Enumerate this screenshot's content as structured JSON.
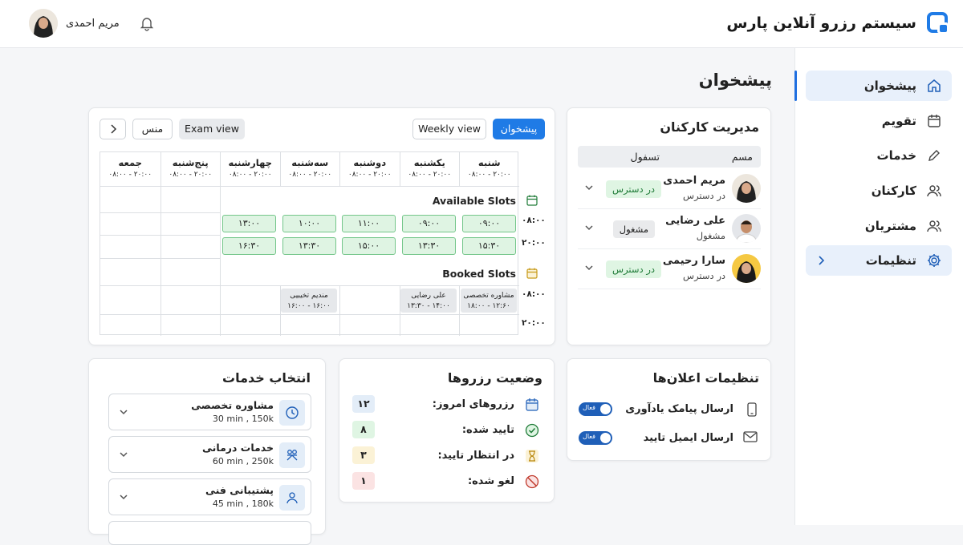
{
  "header": {
    "brand_title": "سیستم رزرو آنلاین پارس",
    "user_name": "مریم احمدی",
    "brand_color": "#1f7be6"
  },
  "sidebar": {
    "items": [
      {
        "label": "پیشخوان",
        "icon": "home-icon",
        "active": true
      },
      {
        "label": "تقویم",
        "icon": "calendar-icon"
      },
      {
        "label": "خدمات",
        "icon": "pencil-icon"
      },
      {
        "label": "کارکنان",
        "icon": "users-icon"
      },
      {
        "label": "مشتریان",
        "icon": "users-icon"
      },
      {
        "label": "تنظیمات",
        "icon": "gear-icon",
        "expandable": true
      }
    ]
  },
  "page": {
    "title": "پیشخوان"
  },
  "staff": {
    "title": "مدیریت کارکنان",
    "columns": [
      "مسم",
      "تسفول"
    ],
    "rows": [
      {
        "name": "مریم احمدی",
        "status": "در دسترس",
        "badge": "در دسترس",
        "badge_type": "green"
      },
      {
        "name": "علی رضایی",
        "status": "مشغول",
        "badge": "مشغول",
        "badge_type": "gray"
      },
      {
        "name": "سارا رحیمی",
        "status": "در دسترس",
        "badge": "در دسترس",
        "badge_type": "green"
      }
    ]
  },
  "calendar": {
    "buttons": {
      "dashboard": "پیشخوان",
      "weekly": "Weekly view",
      "exam": "Exam view",
      "more": "منس"
    },
    "days": [
      {
        "name": "شنبه",
        "hours": "۰۸:۰۰ - ۲۰:۰۰"
      },
      {
        "name": "یکشنبه",
        "hours": "۰۸:۰۰ - ۲۰:۰۰"
      },
      {
        "name": "دوشنبه",
        "hours": "۰۸:۰۰ - ۲۰:۰۰"
      },
      {
        "name": "سه‌شنبه",
        "hours": "۰۸:۰۰ - ۲۰:۰۰"
      },
      {
        "name": "چهارشنبه",
        "hours": "۰۸:۰۰ - ۲۰:۰۰"
      },
      {
        "name": "پنج‌شنبه",
        "hours": "۰۸:۰۰ - ۲۰:۰۰"
      },
      {
        "name": "جمعه",
        "hours": "۰۸:۰۰ - ۲۰:۰۰"
      }
    ],
    "available_label": "Available Slots",
    "booked_label": "Booked Slots",
    "time_labels": [
      "۰۸:۰۰",
      "۲۰:۰۰",
      "۰۸:۰۰",
      "۲۰:۰۰"
    ],
    "slots_row1": [
      "۰۹:۰۰",
      "۰۹:۰۰",
      "۱۱:۰۰",
      "۱۰:۰۰",
      "۱۳:۰۰"
    ],
    "slots_row2": [
      "۱۵:۳۰",
      "۱۳:۳۰",
      "۱۵:۰۰",
      "۱۳:۳۰",
      "۱۶:۳۰"
    ],
    "booked": [
      {
        "title": "مشاوره تخصصی",
        "time": "۱۸:۰۰ - ۱۲:۶۰"
      },
      {
        "title": "علی رضایی",
        "time": "۱۳:۳۰ - ۱۴:۰۰"
      },
      {
        "title": "مندیم تخیبیی",
        "time": "۱۶:۰۰ - ۱۶:۰۰"
      }
    ]
  },
  "notifications": {
    "title": "تنظیمات اعلان‌ها",
    "items": [
      {
        "label": "ارسال پیامک یادآوری",
        "icon": "phone-icon",
        "toggle": "فعال"
      },
      {
        "label": "ارسال ایمیل تایید",
        "icon": "mail-icon",
        "toggle": "فعال"
      }
    ]
  },
  "booking_status": {
    "title": "وضعیت رزروها",
    "items": [
      {
        "label": "رزروهای امروز:",
        "count": "۱۲",
        "icon": "calendar-icon",
        "bg": "#e3edf8"
      },
      {
        "label": "تایید شده:",
        "count": "۸",
        "icon": "check-circle-icon",
        "bg": "#dff5e3"
      },
      {
        "label": "در انتظار تایید:",
        "count": "۳",
        "icon": "hourglass-icon",
        "bg": "#fbf2d6"
      },
      {
        "label": "لغو شده:",
        "count": "۱",
        "icon": "cancel-icon",
        "bg": "#fbe3e3"
      }
    ]
  },
  "services": {
    "title": "انتخاب خدمات",
    "items": [
      {
        "name": "مشاوره تخصصی",
        "meta": "30 min , 150k",
        "icon": "clock-icon"
      },
      {
        "name": "خدمات درمانی",
        "meta": "60 min , 250k",
        "icon": "people-icon"
      },
      {
        "name": "پشتیبانی فنی",
        "meta": "45 min , 180k",
        "icon": "person-icon"
      }
    ]
  }
}
